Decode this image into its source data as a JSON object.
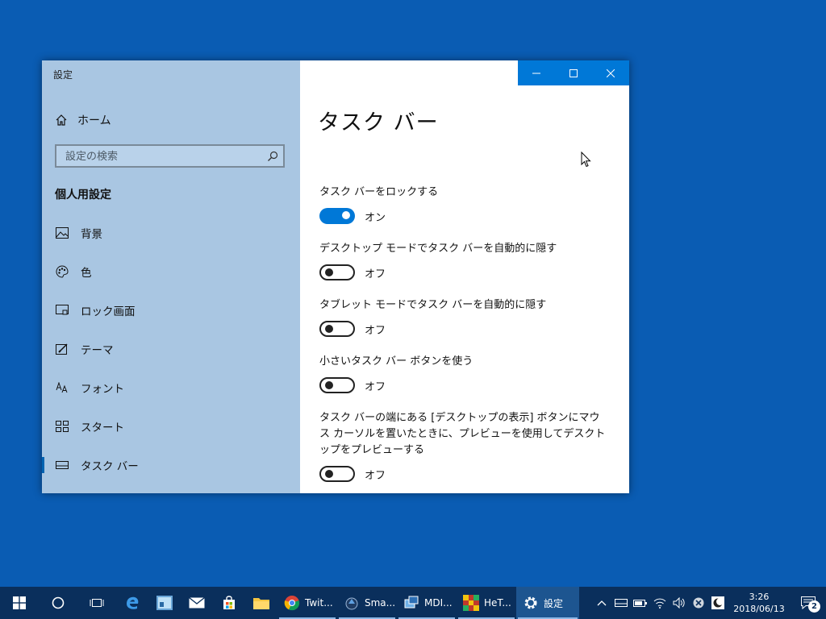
{
  "window": {
    "title": "設定",
    "sidebar": {
      "home_label": "ホーム",
      "search_placeholder": "設定の検索",
      "section_title": "個人用設定",
      "items": [
        {
          "label": "背景",
          "icon": "picture-icon"
        },
        {
          "label": "色",
          "icon": "palette-icon"
        },
        {
          "label": "ロック画面",
          "icon": "lock-screen-icon"
        },
        {
          "label": "テーマ",
          "icon": "theme-icon"
        },
        {
          "label": "フォント",
          "icon": "font-icon"
        },
        {
          "label": "スタート",
          "icon": "start-icon"
        },
        {
          "label": "タスク バー",
          "icon": "taskbar-icon",
          "active": true
        }
      ]
    },
    "content": {
      "title": "タスク バー",
      "settings": [
        {
          "label": "タスク バーをロックする",
          "state": "オン",
          "on": true
        },
        {
          "label": "デスクトップ モードでタスク バーを自動的に隠す",
          "state": "オフ",
          "on": false
        },
        {
          "label": "タブレット モードでタスク バーを自動的に隠す",
          "state": "オフ",
          "on": false
        },
        {
          "label": "小さいタスク バー ボタンを使う",
          "state": "オフ",
          "on": false
        },
        {
          "label": "タスク バーの端にある [デスクトップの表示] ボタンにマウス カーソルを置いたときに、プレビューを使用してデスクトップをプレビューする",
          "state": "オフ",
          "on": false
        }
      ]
    }
  },
  "taskbar": {
    "apps": [
      {
        "label": "Twit...",
        "icon": "chrome-icon"
      },
      {
        "label": "Sma...",
        "icon": "app-icon"
      },
      {
        "label": "MDI...",
        "icon": "app-icon"
      },
      {
        "label": "HeT...",
        "icon": "app-icon"
      },
      {
        "label": "設定",
        "icon": "gear-icon",
        "active": true
      }
    ],
    "clock": {
      "time": "3:26",
      "date": "2018/06/13"
    },
    "notification_count": "2"
  },
  "colors": {
    "accent": "#0078d7",
    "desktop": "#0a5cb3",
    "sidebar": "#a9c6e2",
    "taskbar": "#0a2f5c"
  }
}
